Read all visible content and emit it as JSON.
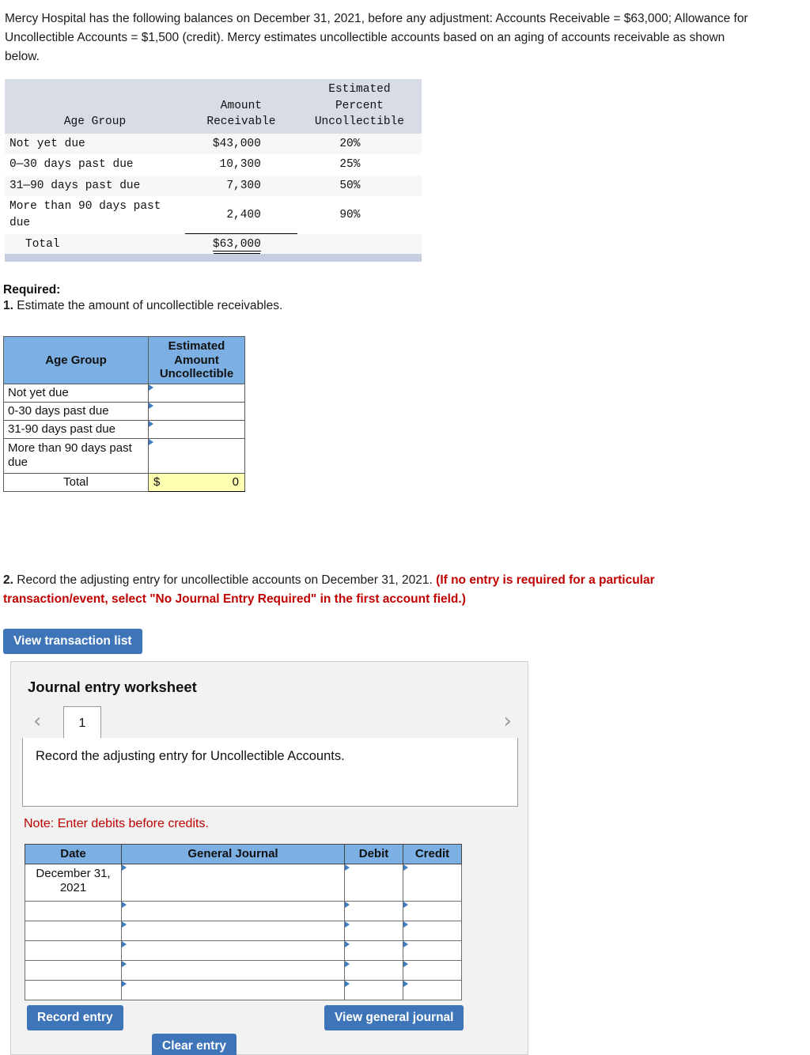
{
  "problem": {
    "statement": "Mercy Hospital has the following balances on December 31, 2021, before any adjustment: Accounts Receivable = $63,000; Allowance for Uncollectible Accounts = $1,500 (credit). Mercy estimates uncollectible accounts based on an aging of accounts receivable as shown below."
  },
  "aging_table": {
    "headers": {
      "age_group": "Age Group",
      "amount_receivable_line1": "Amount",
      "amount_receivable_line2": "Receivable",
      "estimated_line1": "Estimated",
      "estimated_line2": "Percent",
      "estimated_line3": "Uncollectible"
    },
    "rows": [
      {
        "age_group": "Not yet due",
        "amount": "$43,000",
        "percent": "20%"
      },
      {
        "age_group": "0—30 days past due",
        "amount": "10,300",
        "percent": "25%"
      },
      {
        "age_group": "31—90 days past due",
        "amount": "7,300",
        "percent": "50%"
      },
      {
        "age_group": "More than 90 days past due",
        "amount": "2,400",
        "percent": "90%"
      }
    ],
    "total_label": "Total",
    "total_amount": "$63,000"
  },
  "required": {
    "label": "Required:",
    "item1_number": "1.",
    "item1_text": "Estimate the amount of uncollectible receivables.",
    "item2_number": "2.",
    "item2_text": "Record the adjusting entry for uncollectible accounts on December 31, 2021.",
    "item2_note": "(If no entry is required for a particular transaction/event, select \"No Journal Entry Required\" in the first account field.)"
  },
  "answer_table": {
    "header_age_group": "Age Group",
    "header_estimated_line1": "Estimated",
    "header_estimated_line2": "Amount",
    "header_estimated_line3": "Uncollectible",
    "rows": [
      {
        "age_group": "Not yet due",
        "value": ""
      },
      {
        "age_group": "0-30 days past due",
        "value": ""
      },
      {
        "age_group": "31-90 days past due",
        "value": ""
      },
      {
        "age_group": "More than 90 days past due",
        "value": ""
      }
    ],
    "total_label": "Total",
    "total_currency": "$",
    "total_value": "0"
  },
  "buttons": {
    "view_transaction_list": "View transaction list",
    "record_entry": "Record entry",
    "view_general_journal": "View general journal",
    "clear_entry": "Clear entry"
  },
  "worksheet": {
    "title": "Journal entry worksheet",
    "prev_arrow": "‹",
    "next_arrow": "›",
    "active_tab": "1",
    "description": "Record the adjusting entry for Uncollectible Accounts.",
    "note": "Note: Enter debits before credits.",
    "columns": {
      "date": "Date",
      "general_journal": "General Journal",
      "debit": "Debit",
      "credit": "Credit"
    },
    "rows": [
      {
        "date_line1": "December 31,",
        "date_line2": "2021",
        "general_journal": "",
        "debit": "",
        "credit": ""
      },
      {
        "date_line1": "",
        "date_line2": "",
        "general_journal": "",
        "debit": "",
        "credit": ""
      },
      {
        "date_line1": "",
        "date_line2": "",
        "general_journal": "",
        "debit": "",
        "credit": ""
      },
      {
        "date_line1": "",
        "date_line2": "",
        "general_journal": "",
        "debit": "",
        "credit": ""
      },
      {
        "date_line1": "",
        "date_line2": "",
        "general_journal": "",
        "debit": "",
        "credit": ""
      },
      {
        "date_line1": "",
        "date_line2": "",
        "general_journal": "",
        "debit": "",
        "credit": ""
      }
    ]
  },
  "colors": {
    "header_blue": "#7cafe3",
    "button_blue": "#3e74b8",
    "given_table_header": "#d7dce7",
    "total_yellow": "#ffffb0",
    "note_red": "#c00000",
    "panel_bg": "#f2f2f2"
  }
}
